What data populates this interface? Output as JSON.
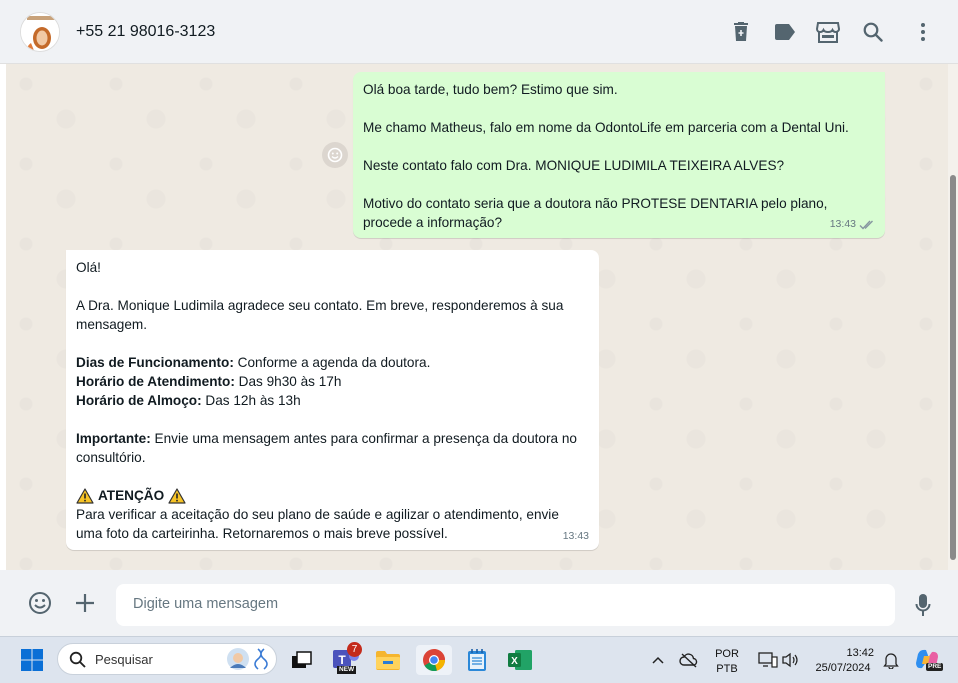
{
  "header": {
    "contact_name": "+55 21 98016-3123",
    "icons": [
      "delete-icon",
      "label-icon",
      "store-icon",
      "search-icon",
      "menu-icon"
    ]
  },
  "messages": {
    "outgoing": {
      "p1": "Olá boa tarde, tudo bem? Estimo que sim.",
      "p2": "Me chamo Matheus, falo em nome da OdontoLife em parceria com a Dental Uni.",
      "p3": "Neste contato falo com Dra. MONIQUE LUDIMILA TEIXEIRA ALVES?",
      "p4": "Motivo do contato seria que a doutora não PROTESE DENTARIA pelo plano, procede a informação?",
      "time": "13:43"
    },
    "incoming": {
      "greeting": "Olá!",
      "thanks": "A Dra. Monique Ludimila agradece seu contato. Em breve, responderemos à sua mensagem.",
      "days_label": "Dias de Funcionamento:",
      "days_value": " Conforme a agenda da doutora.",
      "hours_label": "Horário de Atendimento:",
      "hours_value": " Das 9h30 às 17h",
      "lunch_label": "Horário de Almoço:",
      "lunch_value": " Das 12h às 13h",
      "important_label": "Importante:",
      "important_value": " Envie uma mensagem antes para confirmar a presença da doutora no consultório.",
      "attention": "ATENÇÃO",
      "attention_text": "Para verificar a aceitação do seu plano de saúde e agilizar o atendimento, envie uma foto da carteirinha. Retornaremos o mais breve possível.",
      "time": "13:43"
    }
  },
  "composer": {
    "placeholder": "Digite uma mensagem"
  },
  "taskbar": {
    "search_label": "Pesquisar",
    "teams_badge": "7",
    "teams_label": "NEW",
    "lang_top": "POR",
    "lang_bottom": "PTB",
    "time": "13:42",
    "date": "25/07/2024",
    "copilot_label": "PRE"
  },
  "colors": {
    "outgoing_bubble": "#d9fdd3",
    "incoming_bubble": "#ffffff",
    "chat_background": "#efeae2",
    "header_background": "#f0f2f5"
  }
}
